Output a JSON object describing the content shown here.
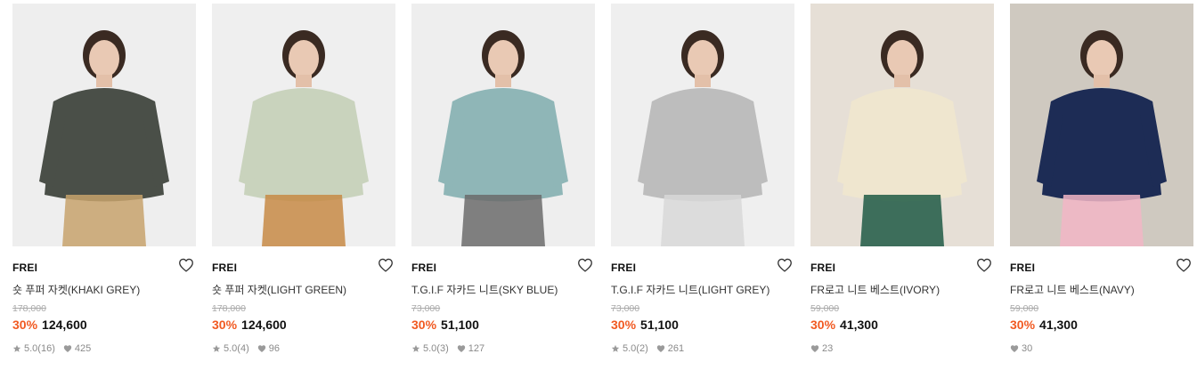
{
  "products": [
    {
      "brand": "FREI",
      "name": "숏 푸퍼 자켓(KHAKI GREY)",
      "original_price": "178,000",
      "discount": "30%",
      "price": "124,600",
      "rating": "5.0",
      "reviews": "(16)",
      "likes": "425",
      "image_bg": "#eeeeee",
      "garment_color": "#4a4f48",
      "accent_color": "#c7a26c"
    },
    {
      "brand": "FREI",
      "name": "숏 푸퍼 자켓(LIGHT GREEN)",
      "original_price": "178,000",
      "discount": "30%",
      "price": "124,600",
      "rating": "5.0",
      "reviews": "(4)",
      "likes": "96",
      "image_bg": "#efefef",
      "garment_color": "#c9d3bd",
      "accent_color": "#c78a45"
    },
    {
      "brand": "FREI",
      "name": "T.G.I.F 자카드 니트(SKY BLUE)",
      "original_price": "73,000",
      "discount": "30%",
      "price": "51,100",
      "rating": "5.0",
      "reviews": "(3)",
      "likes": "127",
      "image_bg": "#eeeeee",
      "garment_color": "#8fb6b7",
      "accent_color": "#6b6b6b"
    },
    {
      "brand": "FREI",
      "name": "T.G.I.F 자카드 니트(LIGHT GREY)",
      "original_price": "73,000",
      "discount": "30%",
      "price": "51,100",
      "rating": "5.0",
      "reviews": "(2)",
      "likes": "261",
      "image_bg": "#efefef",
      "garment_color": "#bdbdbd",
      "accent_color": "#d8d8d8"
    },
    {
      "brand": "FREI",
      "name": "FR로고 니트 베스트(IVORY)",
      "original_price": "59,000",
      "discount": "30%",
      "price": "41,300",
      "rating": "",
      "reviews": "",
      "likes": "23",
      "image_bg": "#e6dfd6",
      "garment_color": "#efe6cf",
      "accent_color": "#1f5a45"
    },
    {
      "brand": "FREI",
      "name": "FR로고 니트 베스트(NAVY)",
      "original_price": "59,000",
      "discount": "30%",
      "price": "41,300",
      "rating": "",
      "reviews": "",
      "likes": "30",
      "image_bg": "#cfc9c0",
      "garment_color": "#1d2c55",
      "accent_color": "#f2b6c6"
    }
  ],
  "colors": {
    "discount": "#f15a22",
    "muted": "#8a8a8a",
    "strike": "#aaaaaa"
  },
  "icons": {
    "wishlist": "heart-outline-icon",
    "rating": "star-icon",
    "likes": "heart-filled-icon"
  }
}
